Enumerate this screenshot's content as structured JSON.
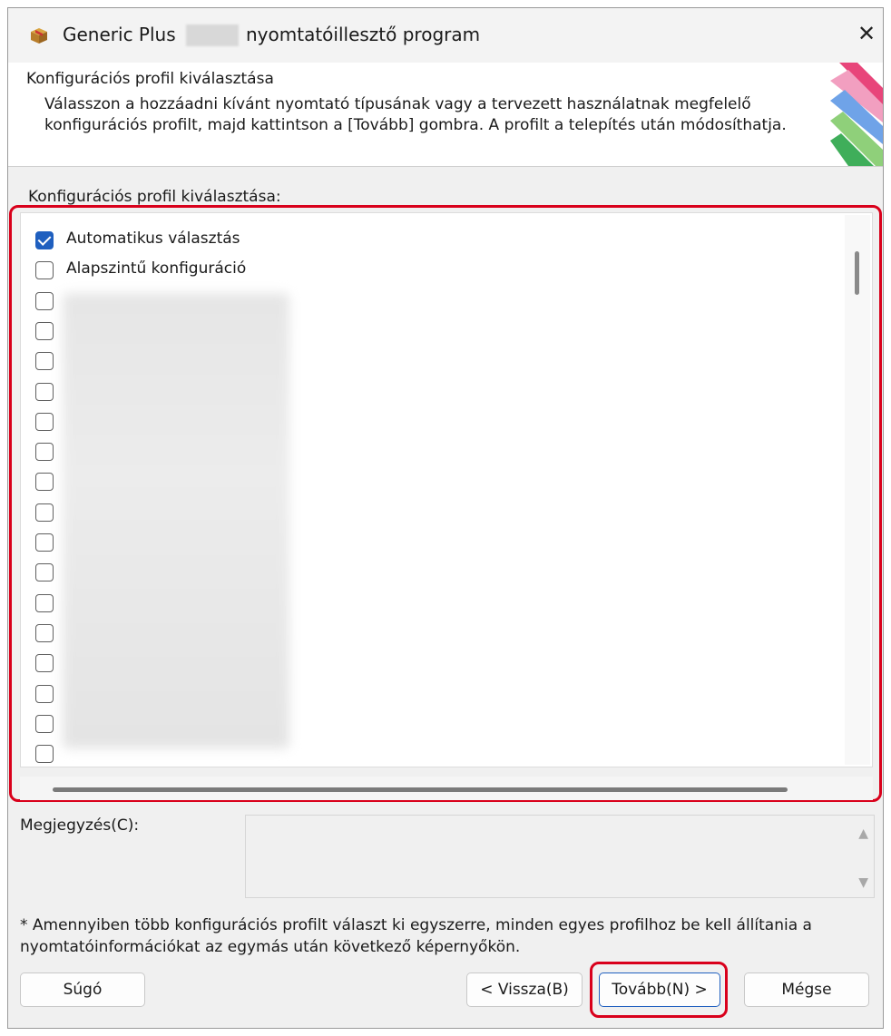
{
  "window": {
    "title_prefix": "Generic Plus",
    "title_suffix": "nyomtatóillesztő program",
    "close_symbol": "✕",
    "icon": "installer-box-icon"
  },
  "header": {
    "title": "Konfigurációs profil kiválasztása",
    "description": "Válasszon a hozzáadni kívánt nyomtató típusának vagy a tervezett használatnak megfelelő konfigurációs profilt, majd kattintson a [Tovább] gombra. A profilt a telepítés után módosíthatja."
  },
  "profile_list": {
    "label": "Konfigurációs profil kiválasztása:",
    "items": [
      {
        "label": "Automatikus választás",
        "checked": true
      },
      {
        "label": "Alapszintű konfiguráció",
        "checked": false
      },
      {
        "label": "",
        "checked": false
      },
      {
        "label": "",
        "checked": false
      },
      {
        "label": "",
        "checked": false
      },
      {
        "label": "",
        "checked": false
      },
      {
        "label": "",
        "checked": false
      },
      {
        "label": "",
        "checked": false
      },
      {
        "label": "",
        "checked": false
      },
      {
        "label": "",
        "checked": false
      },
      {
        "label": "",
        "checked": false
      },
      {
        "label": "",
        "checked": false
      },
      {
        "label": "",
        "checked": false
      },
      {
        "label": "",
        "checked": false
      },
      {
        "label": "",
        "checked": false
      },
      {
        "label": "",
        "checked": false
      },
      {
        "label": "",
        "checked": false
      },
      {
        "label": "",
        "checked": false
      }
    ]
  },
  "note": {
    "label": "Megjegyzés(C):",
    "value": ""
  },
  "footnote": "* Amennyiben több konfigurációs profilt választ ki egyszerre, minden egyes profilhoz be kell állítania a nyomtatóinformációkat az egymás után következő képernyőkön.",
  "buttons": {
    "help": "Súgó",
    "back": "< Vissza(B)",
    "next": "Tovább(N) >",
    "cancel": "Mégse"
  },
  "colors": {
    "highlight": "#d9001b",
    "accent": "#1f5fbf"
  }
}
